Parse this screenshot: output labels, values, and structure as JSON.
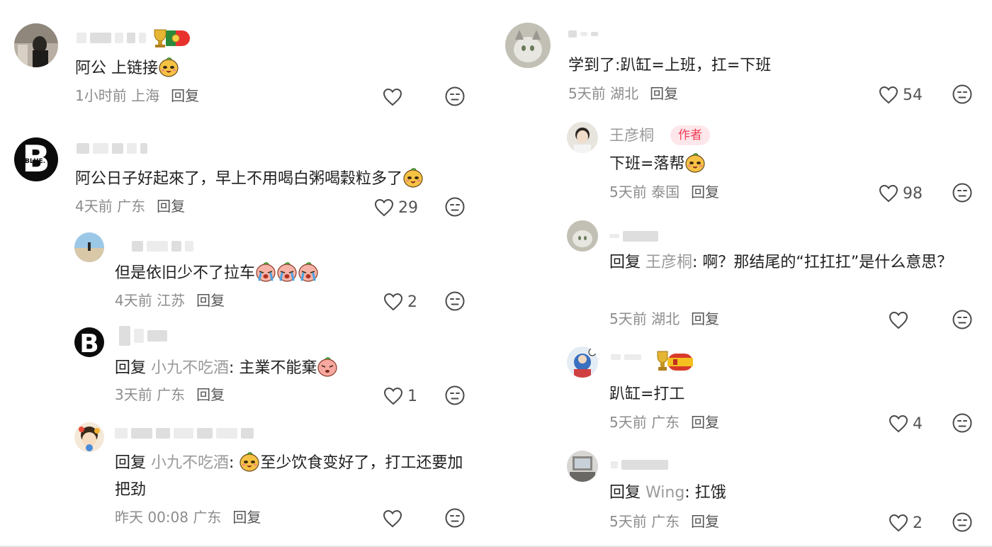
{
  "left": [
    {
      "text": "阿公 上链接",
      "time": "1小时前",
      "location": "上海",
      "reply": "回复",
      "likes": ""
    },
    {
      "text": "阿公日子好起來了，早上不用喝白粥喝穀粒多了",
      "time": "4天前",
      "location": "广东",
      "reply": "回复",
      "likes": "29"
    },
    {
      "text": "但是依旧少不了拉车",
      "time": "4天前",
      "location": "江苏",
      "reply": "回复",
      "likes": "2"
    },
    {
      "reply_prefix": "回复 ",
      "reply_to": "小九不吃酒",
      "text": ": 主業不能棄",
      "time": "3天前",
      "location": "广东",
      "reply": "回复",
      "likes": "1"
    },
    {
      "reply_prefix": "回复 ",
      "reply_to": "小九不吃酒",
      "text_a": ": ",
      "text_b": "至少饮食变好了，打工还要加把劲",
      "time": "昨天 00:08",
      "location": "广东",
      "reply": "回复",
      "likes": ""
    }
  ],
  "right": [
    {
      "text": "学到了:趴缸=上班，扛=下班",
      "time": "5天前",
      "location": "湖北",
      "reply": "回复",
      "likes": "54"
    },
    {
      "name": "王彦桐",
      "badge": "作者",
      "text": "下班=落帮",
      "time": "5天前",
      "location": "泰国",
      "reply": "回复",
      "likes": "98"
    },
    {
      "reply_prefix": "回复 ",
      "reply_to": "王彦桐",
      "text": ": 啊？那结尾的“扛扛扛”是什么意思？",
      "time": "5天前",
      "location": "湖北",
      "reply": "回复",
      "likes": ""
    },
    {
      "text": "趴缸=打工",
      "time": "5天前",
      "location": "广东",
      "reply": "回复",
      "likes": "4"
    },
    {
      "reply_prefix": "回复 ",
      "reply_to": "Wing",
      "text": ": 扛饿",
      "time": "5天前",
      "location": "广东",
      "reply": "回复",
      "likes": "2"
    }
  ],
  "icons": {
    "like": "heart-outline-icon",
    "dislike": "meh-face-icon",
    "emoji_happy": "happy-mango-emoji",
    "emoji_cry": "crying-face-emoji",
    "emoji_pout": "pout-face-emoji"
  },
  "colors": {
    "author_badge": "#f23c57",
    "reply_name": "#9a9a9a",
    "meta": "#8c8c8c"
  }
}
